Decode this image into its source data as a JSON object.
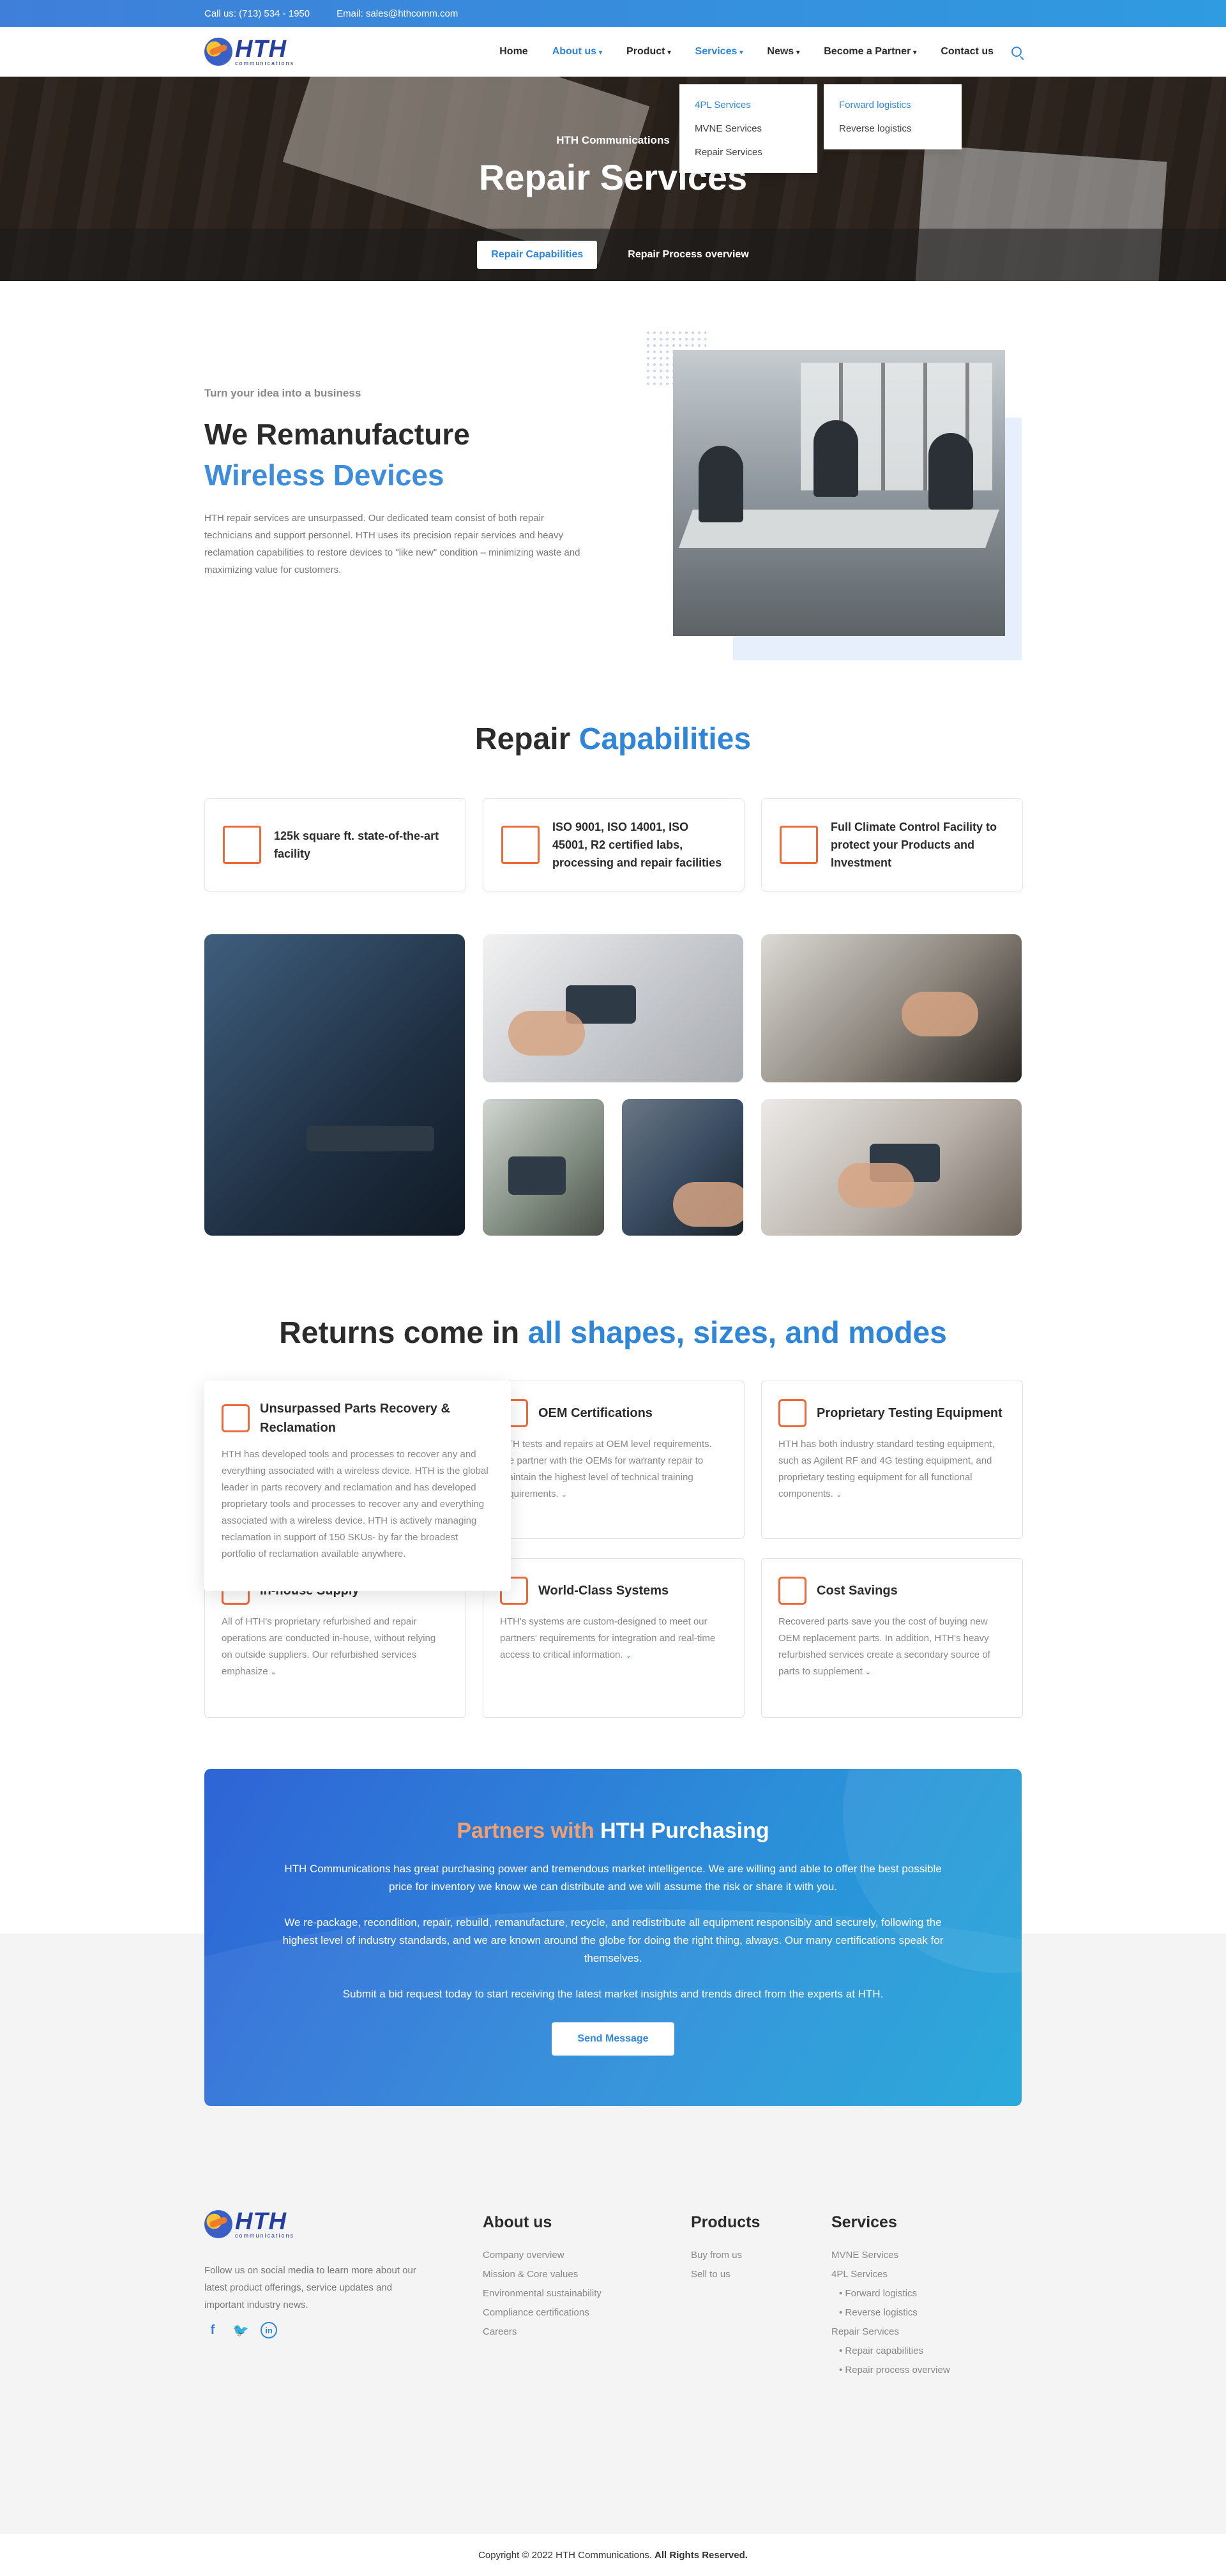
{
  "topbar": {
    "phone": "Call us: (713) 534 - 1950",
    "email": "Email: sales@hthcomm.com"
  },
  "logo": {
    "text": "HTH",
    "sub": "communications"
  },
  "nav": {
    "items": [
      "Home",
      "About us",
      "Product",
      "Services",
      "News",
      "Become a Partner",
      "Contact us"
    ],
    "services_menu": [
      "4PL Services",
      "MVNE Services",
      "Repair Services"
    ],
    "logistics_menu": [
      "Forward logistics",
      "Reverse logistics"
    ]
  },
  "hero": {
    "subtitle": "HTH Communications",
    "title": "Repair Services",
    "btn_capabilities": "Repair Capabilities",
    "link_process": "Repair Process overview"
  },
  "intro": {
    "eyebrow": "Turn your idea into a business",
    "title_line1": "We Remanufacture",
    "title_line2": "Wireless Devices",
    "body": "HTH repair services are unsurpassed. Our dedicated team consist of both repair technicians and support personnel. HTH uses its precision repair services and heavy reclamation capabilities to restore devices to \"like new\" condition – minimizing waste and maximizing value for customers."
  },
  "capabilities": {
    "title_a": "Repair ",
    "title_b": "Capabilities",
    "cards": [
      {
        "icon": "blueprint-pencil-icon",
        "text": "125k square ft. state-of-the-art facility"
      },
      {
        "icon": "certificate-icon",
        "text": "ISO 9001, ISO 14001, ISO 45001, R2 certified labs, processing and repair facilities"
      },
      {
        "icon": "warehouse-icon",
        "text": "Full Climate Control Facility to protect your Products and Investment"
      }
    ]
  },
  "returns": {
    "title_a": "Returns come in ",
    "title_b": "all shapes, sizes, and modes",
    "cards": [
      {
        "icon": "recycle-box-icon",
        "title": "Unsurpassed Parts Recovery & Reclamation",
        "body": "HTH has developed tools and processes to recover any and everything associated with a wireless device. HTH is the global leader in parts recovery and reclamation and has developed proprietary tools and processes to recover any and everything associated with a wireless device. HTH is actively managing reclamation in support of 150 SKUs- by far the broadest portfolio of reclamation available anywhere."
      },
      {
        "icon": "certificate-icon",
        "title": "OEM Certifications",
        "body": "HTH tests and repairs at OEM level requirements. We partner with the OEMs for warranty repair to maintain the highest level of technical training requirements.",
        "more": "⌄"
      },
      {
        "icon": "phone-icon",
        "title": "Proprietary Testing Equipment",
        "body": "HTH has both industry standard testing equipment, such as Agilent RF and 4G testing equipment, and proprietary testing equipment for all functional components.",
        "more": "⌄"
      },
      {
        "icon": "inbox-icon",
        "title": "In-house Supply",
        "body": "All of HTH's proprietary refurbished and repair operations are conducted in-house, without relying on outside suppliers. Our refurbished services emphasize",
        "more": "⌄"
      },
      {
        "icon": "monitor-gear-icon",
        "title": "World-Class Systems",
        "body": "HTH's systems are custom-designed to meet our partners' requirements for integration and real-time access to critical information.",
        "more": "⌄"
      },
      {
        "icon": "piggy-bank-icon",
        "title": "Cost Savings",
        "body": "Recovered parts save you the cost of buying new OEM replacement parts. In addition, HTH's heavy refurbished services create a secondary source of parts to supplement",
        "more": "⌄"
      }
    ]
  },
  "purchasing": {
    "title_a": "Partners with ",
    "title_b": "HTH Purchasing",
    "p1": "HTH Communications has great purchasing power and tremendous market intelligence. We are willing and able to offer the best possible price for inventory we know we can distribute and we will assume the risk or share it with you.",
    "p2": "We re-package, recondition, repair, rebuild, remanufacture, recycle, and redistribute all equipment responsibly and securely, following the highest level of industry standards, and we are known around the globe for doing the right thing, always. Our many certifications speak for themselves.",
    "p3": "Submit a bid request today to start receiving the latest market insights and trends direct from the experts at HTH.",
    "button": "Send Message"
  },
  "footer": {
    "text": "Follow us on social media to learn more about our latest product offerings, service updates and important industry news.",
    "about": {
      "title": "About us",
      "links": [
        "Company overview",
        "Mission & Core values",
        "Environmental sustainability",
        "Compliance certifications",
        "Careers"
      ]
    },
    "products": {
      "title": "Products",
      "links": [
        "Buy from us",
        "Sell to us"
      ]
    },
    "services": {
      "title": "Services",
      "links": [
        "MVNE Services",
        "4PL Services",
        "Forward logistics",
        "Reverse logistics",
        "Repair Services",
        "Repair capabilities",
        "Repair process overview"
      ]
    },
    "copyright": "Copyright © 2022 HTH Communications.",
    "rights": "All Rights Reserved."
  },
  "colors": {
    "accent": "#2f86d8",
    "orange": "#ec6a3a"
  }
}
